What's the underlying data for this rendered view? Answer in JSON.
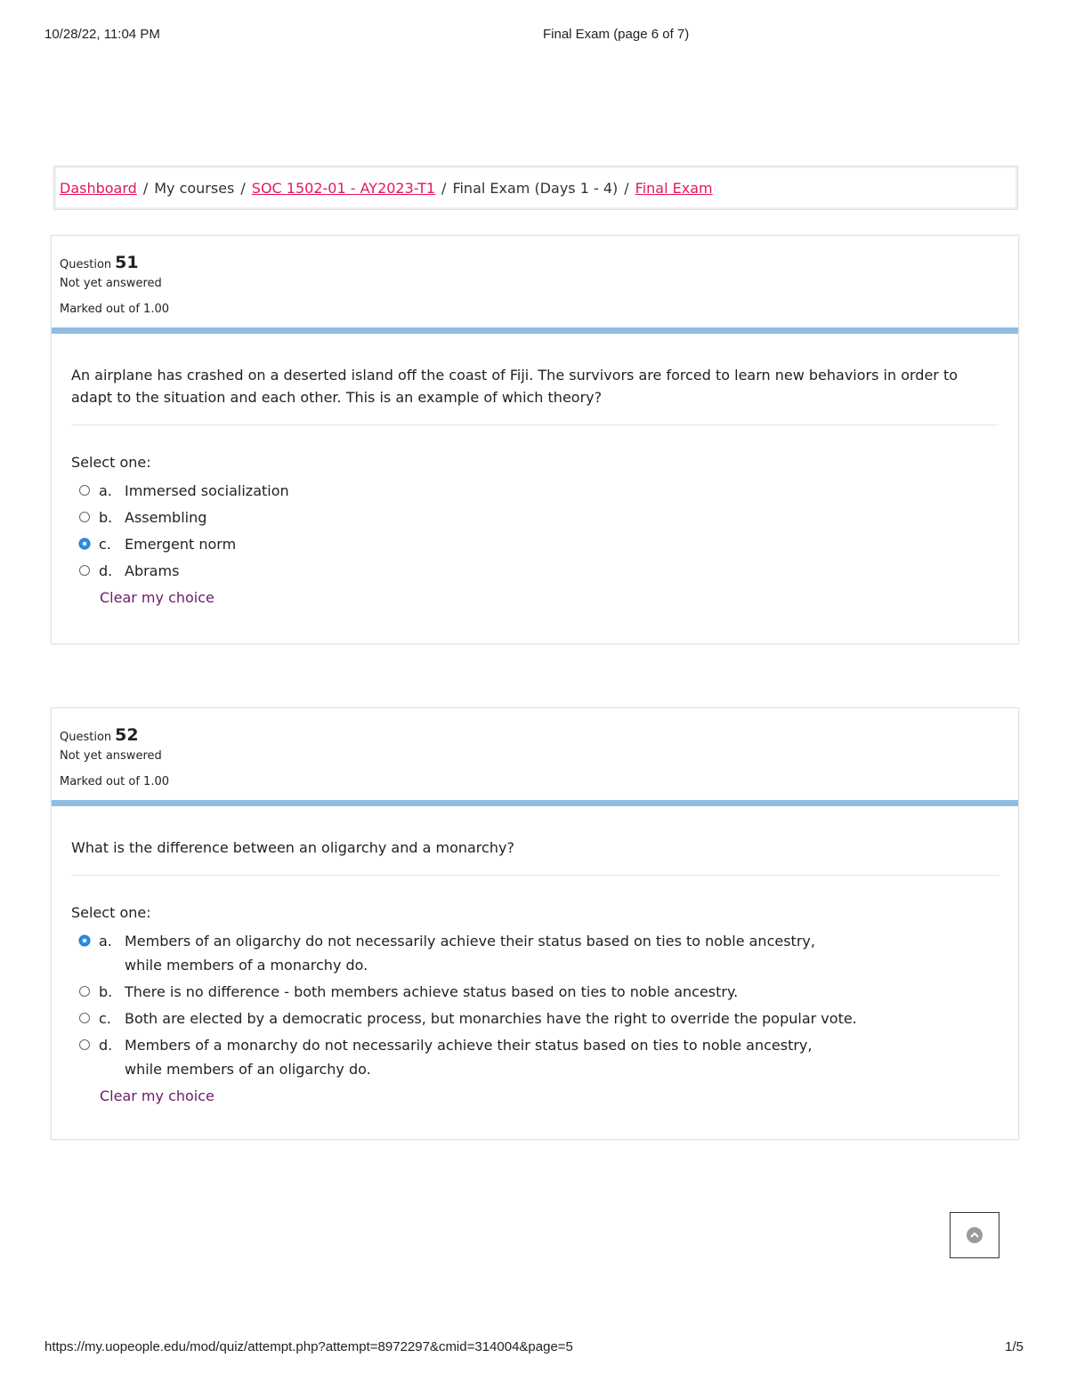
{
  "print_header": {
    "datetime": "10/28/22, 11:04 PM",
    "title": "Final Exam (page 6 of 7)"
  },
  "breadcrumb": {
    "items": [
      {
        "label": "Dashboard"
      },
      {
        "label": "My courses"
      },
      {
        "label": "SOC 1502-01 - AY2023-T1"
      },
      {
        "label": "Final Exam (Days 1 - 4)"
      },
      {
        "label": "Final Exam"
      }
    ],
    "separator": "/"
  },
  "questions": [
    {
      "label": "Question",
      "number": "51",
      "state": "Not yet answered",
      "grade": "Marked out of 1.00",
      "text": "An airplane has crashed on a deserted island off the coast of Fiji. The survivors are forced to learn new behaviors in order to adapt to the situation and each other. This is an example of which theory?",
      "prompt": "Select one:",
      "options": [
        {
          "letter": "a.",
          "text": "Immersed socialization"
        },
        {
          "letter": "b.",
          "text": "Assembling"
        },
        {
          "letter": "c.",
          "text": "Emergent norm"
        },
        {
          "letter": "d.",
          "text": "Abrams"
        }
      ],
      "clear_label": "Clear my choice"
    },
    {
      "label": "Question",
      "number": "52",
      "state": "Not yet answered",
      "grade": "Marked out of 1.00",
      "text": "What is the difference between an oligarchy and a monarchy?",
      "prompt": "Select one:",
      "options": [
        {
          "letter": "a.",
          "text": "Members of an oligarchy do not necessarily achieve their status based on ties to noble ancestry, while members of a monarchy do."
        },
        {
          "letter": "b.",
          "text": "There is no difference - both members achieve status based on ties to noble ancestry."
        },
        {
          "letter": "c.",
          "text": "Both are elected by a democratic process, but monarchies have the right to override the popular vote."
        },
        {
          "letter": "d.",
          "text": "Members of a monarchy do not necessarily achieve their status based on ties to noble ancestry, while members of an oligarchy do."
        }
      ],
      "clear_label": "Clear my choice"
    }
  ],
  "print_footer": {
    "url": "https://my.uopeople.edu/mod/quiz/attempt.php?attempt=8972297&cmid=314004&page=5",
    "page": "1/5"
  },
  "colors": {
    "link": "#e4185c",
    "clear_link": "#6a1b6b",
    "info_bar": "#8fbce3",
    "radio_checked": "#3d8fe0"
  },
  "icons": {
    "back_to_top": "chevron-up-circle-icon"
  }
}
